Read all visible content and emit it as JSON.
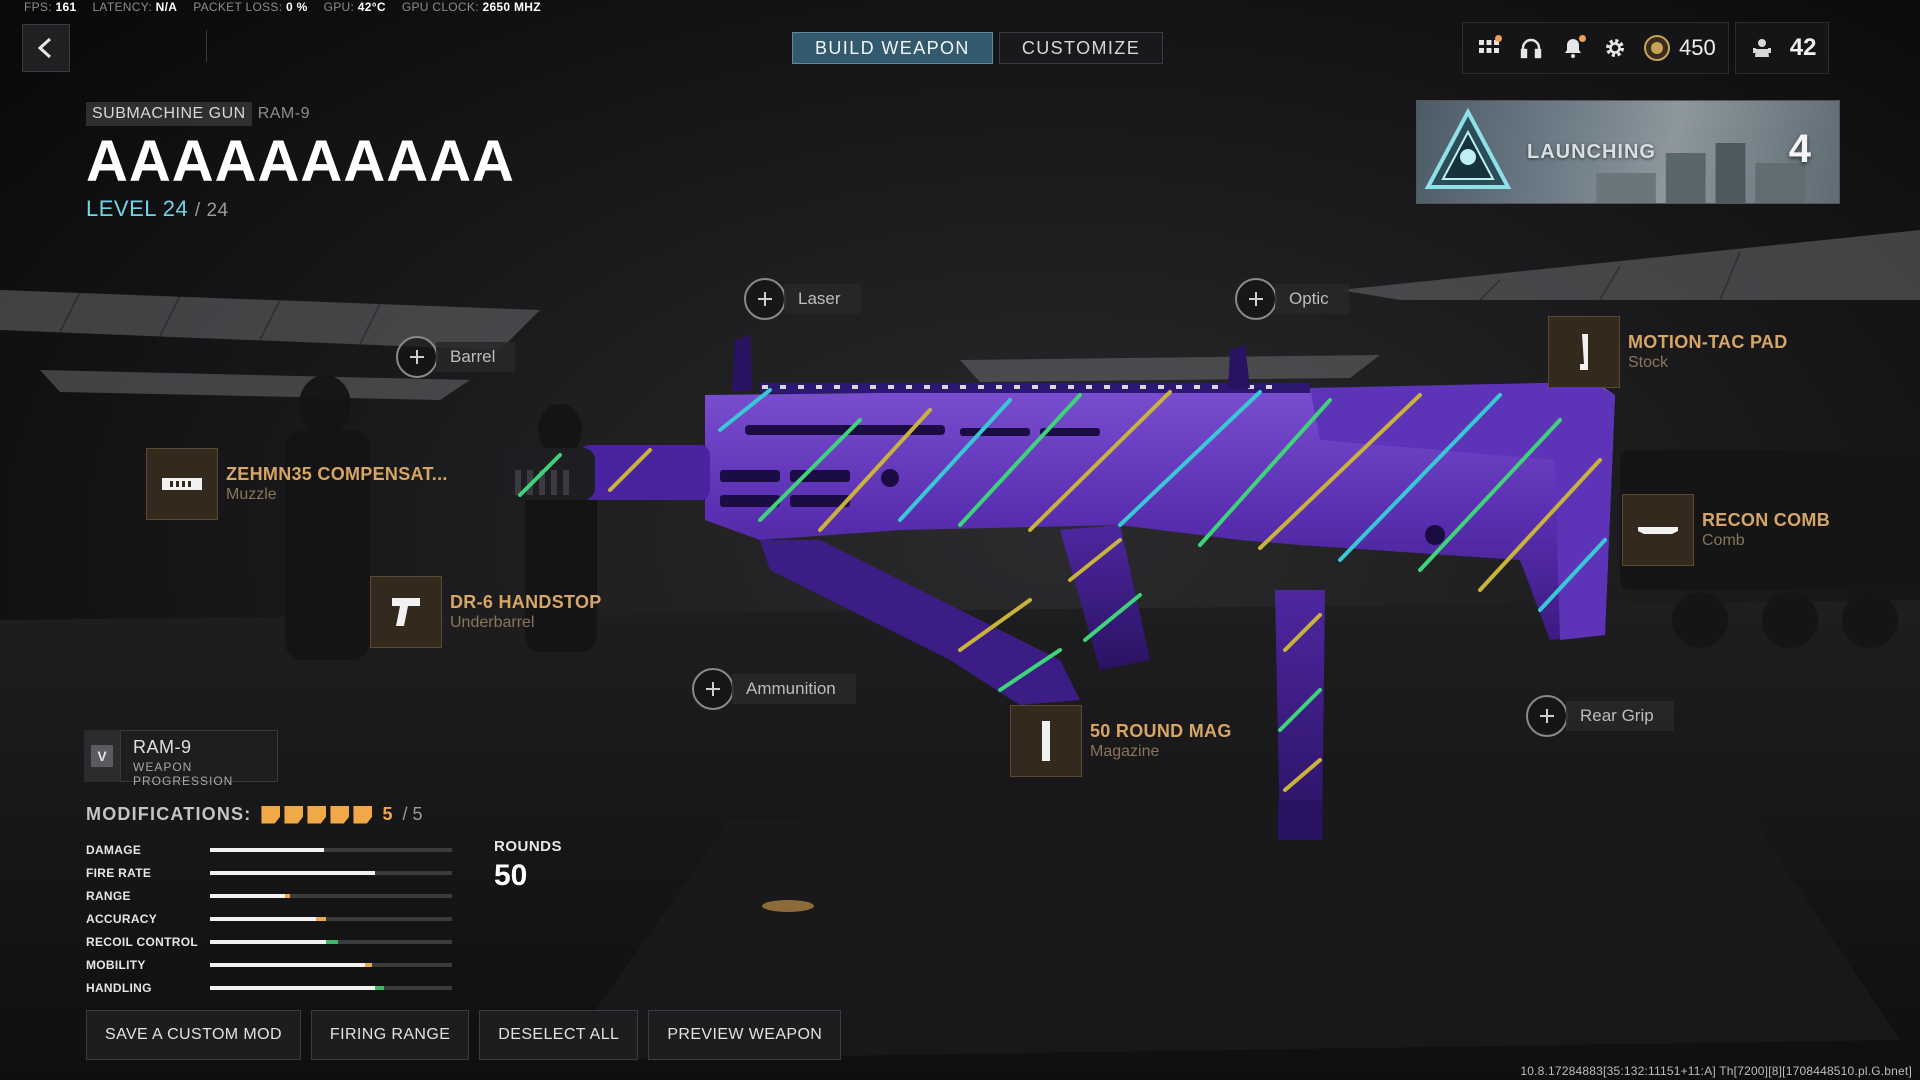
{
  "perf": [
    {
      "label": "FPS:",
      "value": "161"
    },
    {
      "label": "LATENCY:",
      "value": "N/A"
    },
    {
      "label": "PACKET LOSS:",
      "value": "0 %"
    },
    {
      "label": "GPU:",
      "value": "42°C"
    },
    {
      "label": "GPU CLOCK:",
      "value": "2650 MHZ"
    }
  ],
  "tabs": [
    {
      "label": "BUILD WEAPON",
      "active": true
    },
    {
      "label": "CUSTOMIZE",
      "active": false
    }
  ],
  "topbar": {
    "icons": [
      "apps-grid-icon",
      "headset-icon",
      "bell-icon",
      "gear-icon"
    ],
    "cod_points": "450",
    "player_level": "42"
  },
  "launching": {
    "label": "LAUNCHING",
    "count": "4"
  },
  "weapon": {
    "class": "SUBMACHINE GUN",
    "name": "RAM-9",
    "title": "AAAAAAAAAA",
    "level_label": "LEVEL 24",
    "level_max": "/ 24"
  },
  "slots_empty": {
    "barrel": "Barrel",
    "laser": "Laser",
    "optic": "Optic",
    "ammunition": "Ammunition",
    "rear_grip": "Rear Grip"
  },
  "attachments": {
    "muzzle": {
      "name": "ZEHMN35 COMPENSAT...",
      "type": "Muzzle"
    },
    "underbarrel": {
      "name": "DR-6 HANDSTOP",
      "type": "Underbarrel"
    },
    "stock": {
      "name": "MOTION-TAC PAD",
      "type": "Stock"
    },
    "comb": {
      "name": "RECON COMB",
      "type": "Comb"
    },
    "magazine": {
      "name": "50 ROUND MAG",
      "type": "Magazine"
    }
  },
  "progression": {
    "key": "V",
    "name": "RAM-9",
    "subtitle": "WEAPON PROGRESSION"
  },
  "modifications": {
    "label": "MODIFICATIONS:",
    "count": "5",
    "max": "/ 5",
    "filled": 5
  },
  "stats": [
    {
      "label": "DAMAGE",
      "base": 0.47,
      "mod": 0.0,
      "mod_color": "#f2f2f2"
    },
    {
      "label": "FIRE RATE",
      "base": 0.68,
      "mod": 0.0,
      "mod_color": "#f2f2f2"
    },
    {
      "label": "RANGE",
      "base": 0.31,
      "mod": 0.02,
      "mod_color": "#f0a946"
    },
    {
      "label": "ACCURACY",
      "base": 0.44,
      "mod": 0.04,
      "mod_color": "#f0a946"
    },
    {
      "label": "RECOIL CONTROL",
      "base": 0.48,
      "mod": 0.05,
      "mod_color": "#3fb86a"
    },
    {
      "label": "MOBILITY",
      "base": 0.64,
      "mod": 0.03,
      "mod_color": "#f0a946"
    },
    {
      "label": "HANDLING",
      "base": 0.68,
      "mod": 0.04,
      "mod_color": "#3fb86a"
    }
  ],
  "rounds": {
    "label": "ROUNDS",
    "value": "50"
  },
  "buttons": [
    "SAVE A CUSTOM MOD",
    "FIRING RANGE",
    "DESELECT ALL",
    "PREVIEW WEAPON"
  ],
  "build_info": "10.8.17284883[35:132:11151+11:A] Th[7200][8][1708448510.pl.G.bnet]"
}
